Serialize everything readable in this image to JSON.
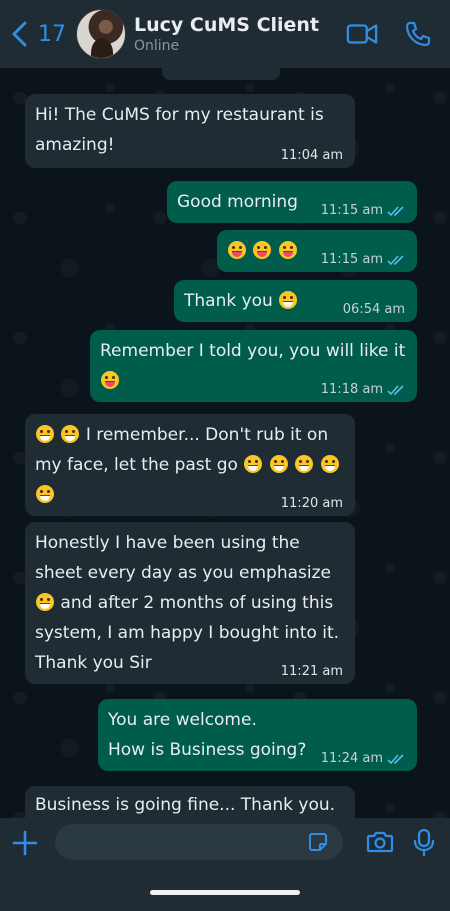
{
  "header": {
    "back_count": "17",
    "contact_name": "Lucy CuMS Client",
    "status": "Online",
    "icons": [
      "back-chevron-icon",
      "video-call-icon",
      "phone-call-icon"
    ]
  },
  "messages": [
    {
      "direction": "in",
      "text": "Hi! The CuMS for my restaurant is amazing!",
      "time": "11:04 am"
    },
    {
      "direction": "out",
      "text": "Good morning",
      "time": "11:15 am",
      "read": true
    },
    {
      "direction": "out",
      "emoji": [
        "smiling-face",
        "smiling-face",
        "smiling-face"
      ],
      "time": "11:15 am",
      "read": true
    },
    {
      "direction": "out",
      "text": "Thank you",
      "emoji": [
        "grinning-face"
      ],
      "time": "06:54 am",
      "read": false
    },
    {
      "direction": "out",
      "text": "Remember I told you, you will like it",
      "emoji": [
        "tongue-face"
      ],
      "time": "11:18 am",
      "read": true
    },
    {
      "direction": "in",
      "text": "I remember... Don't rub it on my face, let the past go",
      "emoji_before": [
        "grinning-face",
        "grinning-face"
      ],
      "emoji": [
        "laughing-face",
        "laughing-face",
        "laughing-face",
        "laughing-face",
        "laughing-face"
      ],
      "time": "11:20 am"
    },
    {
      "direction": "in",
      "text_a": "Honestly I have been using the sheet every day as you emphasize",
      "text_b": "and after 2 months of using this system, I am happy I bought into it. Thank you Sir",
      "emoji": [
        "grinning-face"
      ],
      "time": "11:21 am"
    },
    {
      "direction": "out",
      "text_a": "You are welcome.",
      "text_b": "How is Business going?",
      "time": "11:24 am",
      "read": true
    },
    {
      "direction": "in",
      "text": "Business is going fine... Thank you."
    }
  ],
  "composer": {
    "value": "",
    "icons": [
      "plus-icon",
      "sticker-icon",
      "camera-icon",
      "microphone-icon"
    ]
  },
  "colors": {
    "background": "#0b141a",
    "header": "#1f2c34",
    "incoming_bubble": "#202c33",
    "outgoing_bubble": "#005c4b",
    "accent": "#2f8fe8"
  }
}
